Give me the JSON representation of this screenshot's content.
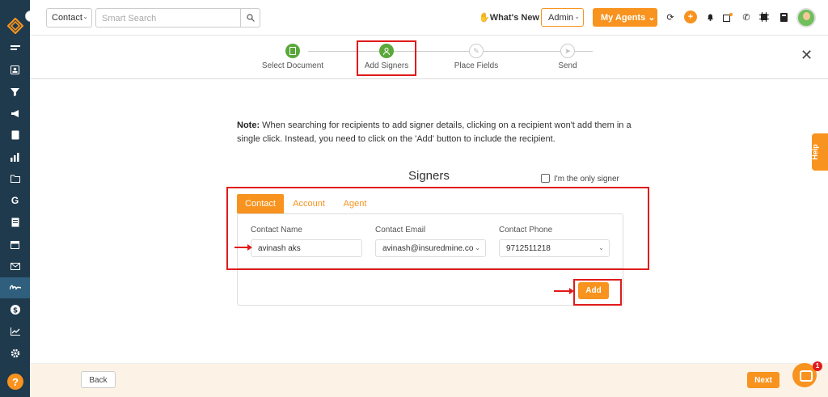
{
  "topbar": {
    "entity_select": "Contact",
    "search_placeholder": "Smart Search",
    "whats_new": "What's New",
    "role_select": "Admin",
    "my_agents": "My Agents"
  },
  "stepper": {
    "steps": [
      {
        "label": "Select Document",
        "icon": "document-icon",
        "state": "done"
      },
      {
        "label": "Add Signers",
        "icon": "user-icon",
        "state": "current"
      },
      {
        "label": "Place Fields",
        "icon": "edit-icon",
        "state": "todo"
      },
      {
        "label": "Send",
        "icon": "send-icon",
        "state": "todo"
      }
    ]
  },
  "note": {
    "prefix": "Note:",
    "text": " When searching for recipients to add signer details, clicking on a recipient won't add them in a single click. Instead, you need to click on the 'Add' button to include the recipient."
  },
  "signers": {
    "title": "Signers",
    "only_signer_label": "I'm the only signer",
    "only_signer_checked": false,
    "tabs": [
      "Contact",
      "Account",
      "Agent"
    ],
    "active_tab": "Contact",
    "fields": {
      "name_label": "Contact Name",
      "name_value": "avinash aks",
      "email_label": "Contact Email",
      "email_value": "avinash@insuredmine.co",
      "phone_label": "Contact Phone",
      "phone_value": "9712511218"
    },
    "add_button": "Add"
  },
  "help_tab": "Help",
  "footer": {
    "back": "Back",
    "next": "Next"
  },
  "chat_badge": "1",
  "colors": {
    "accent": "#f7931e",
    "sidebar": "#1f3a4d",
    "success": "#5aa83a",
    "annotation": "#e01b1b"
  }
}
